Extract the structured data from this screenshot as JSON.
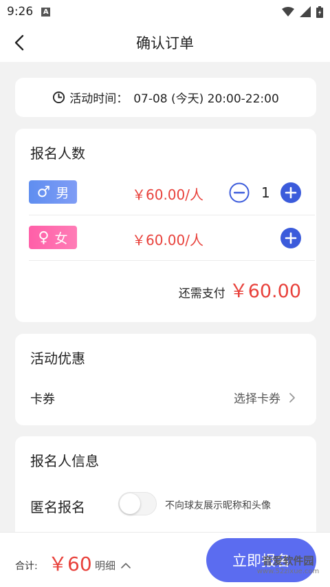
{
  "status_bar": {
    "time": "9:26",
    "notice_icon": "A"
  },
  "nav": {
    "title": "确认订单",
    "back_icon": "chevron-left-icon"
  },
  "activity_time": {
    "label": "活动时间：",
    "value": "07-08 (今天) 20:00-22:00",
    "icon": "clock-icon"
  },
  "signup_count": {
    "title": "报名人数",
    "male": {
      "badge_symbol": "♂",
      "badge_label": "男",
      "price": "￥60.00/人",
      "quantity": "1"
    },
    "female": {
      "badge_symbol": "♀",
      "badge_label": "女",
      "price": "￥60.00/人"
    },
    "total_label": "还需支付",
    "total_amount": "￥60.00"
  },
  "promotion": {
    "title": "活动优惠",
    "coupon_label": "卡券",
    "coupon_action": "选择卡券"
  },
  "registrant_info": {
    "title": "报名人信息",
    "anonymous_label": "匿名报名",
    "anonymous_hint": "不向球友展示昵称和头像",
    "anonymous_enabled": false
  },
  "footer": {
    "sum_label": "合计:",
    "sum_amount": "￥60",
    "detail_label": "明细",
    "signup_button": "立即报名"
  },
  "watermark": {
    "title": "音爱软件园",
    "url": "www.52zixue.com"
  },
  "colors": {
    "accent": "#5b6cf0",
    "price_red": "#e8413b",
    "male": "#6f95f2",
    "female": "#ff6bb0"
  }
}
